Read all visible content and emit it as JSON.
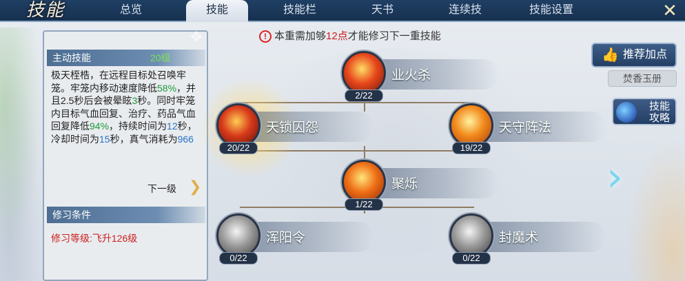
{
  "header": {
    "logo_text": "技能",
    "tabs": [
      {
        "label": "总览"
      },
      {
        "label": "技能"
      },
      {
        "label": "技能栏"
      },
      {
        "label": "天书"
      },
      {
        "label": "连续技"
      },
      {
        "label": "技能设置"
      }
    ],
    "active_tab": "技能"
  },
  "panel": {
    "section_title": "主动技能",
    "level": "20级",
    "description": {
      "p1": "极天桎梏，在远程目标处召唤牢笼。牢笼内移动速度降低",
      "v1": "58%",
      "p2": "，并且2.5秒后会被晕眩",
      "v2": "3",
      "p3": "秒。同时牢笼内目标气血回复、治疗、药品气血回复降低",
      "v3": "94%",
      "p4": "，持续时间为",
      "v4": "12",
      "p5": "秒，冷却时间为",
      "v5": "15",
      "p6": "秒，真气消耗为",
      "v6": "966"
    },
    "next_level_label": "下一级",
    "condition_title": "修习条件",
    "condition_text": "修习等级:飞升126级"
  },
  "notice": {
    "prefix": "本重需加够",
    "points": "12点",
    "suffix": "才能修习下一重技能"
  },
  "skills": [
    {
      "name": "业火杀",
      "count": "2/22",
      "colors": [
        "#ffdd66",
        "#e8471c",
        "#6a1608"
      ]
    },
    {
      "name": "天锁囚怨",
      "count": "20/22",
      "colors": [
        "#ffcc55",
        "#d8391a",
        "#5a0f08"
      ]
    },
    {
      "name": "天守阵法",
      "count": "19/22",
      "colors": [
        "#fff3a0",
        "#f28a1c",
        "#a83a0c"
      ]
    },
    {
      "name": "聚烁",
      "count": "1/22",
      "colors": [
        "#ffe57a",
        "#ef6e16",
        "#8a2a08"
      ]
    },
    {
      "name": "浑阳令",
      "count": "0/22",
      "colors": [
        "#f4f4f4",
        "#9b9b9b",
        "#3d3d3d"
      ]
    },
    {
      "name": "封魔术",
      "count": "0/22",
      "colors": [
        "#f4f4f4",
        "#9b9b9b",
        "#3d3d3d"
      ]
    }
  ],
  "right": {
    "recommend_label": "推荐加点",
    "book_label": "焚香玉册",
    "guide_line1": "技能",
    "guide_line2": "攻略"
  }
}
